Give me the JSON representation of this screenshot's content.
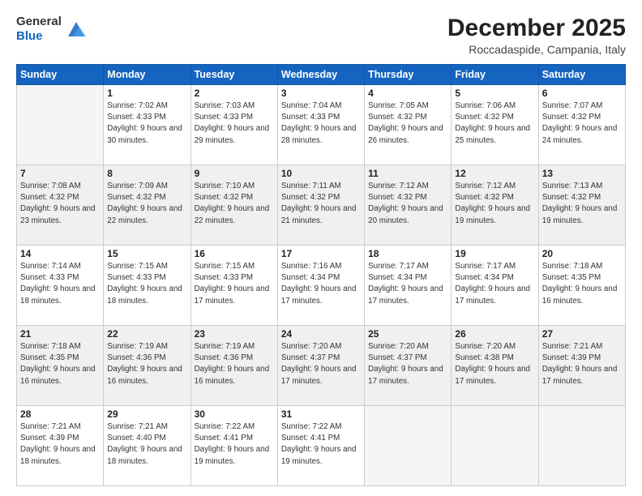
{
  "logo": {
    "general": "General",
    "blue": "Blue"
  },
  "header": {
    "month": "December 2025",
    "location": "Roccadaspide, Campania, Italy"
  },
  "weekdays": [
    "Sunday",
    "Monday",
    "Tuesday",
    "Wednesday",
    "Thursday",
    "Friday",
    "Saturday"
  ],
  "weeks": [
    [
      {
        "day": "",
        "sunrise": "",
        "sunset": "",
        "daylight": ""
      },
      {
        "day": "1",
        "sunrise": "Sunrise: 7:02 AM",
        "sunset": "Sunset: 4:33 PM",
        "daylight": "Daylight: 9 hours and 30 minutes."
      },
      {
        "day": "2",
        "sunrise": "Sunrise: 7:03 AM",
        "sunset": "Sunset: 4:33 PM",
        "daylight": "Daylight: 9 hours and 29 minutes."
      },
      {
        "day": "3",
        "sunrise": "Sunrise: 7:04 AM",
        "sunset": "Sunset: 4:33 PM",
        "daylight": "Daylight: 9 hours and 28 minutes."
      },
      {
        "day": "4",
        "sunrise": "Sunrise: 7:05 AM",
        "sunset": "Sunset: 4:32 PM",
        "daylight": "Daylight: 9 hours and 26 minutes."
      },
      {
        "day": "5",
        "sunrise": "Sunrise: 7:06 AM",
        "sunset": "Sunset: 4:32 PM",
        "daylight": "Daylight: 9 hours and 25 minutes."
      },
      {
        "day": "6",
        "sunrise": "Sunrise: 7:07 AM",
        "sunset": "Sunset: 4:32 PM",
        "daylight": "Daylight: 9 hours and 24 minutes."
      }
    ],
    [
      {
        "day": "7",
        "sunrise": "Sunrise: 7:08 AM",
        "sunset": "Sunset: 4:32 PM",
        "daylight": "Daylight: 9 hours and 23 minutes."
      },
      {
        "day": "8",
        "sunrise": "Sunrise: 7:09 AM",
        "sunset": "Sunset: 4:32 PM",
        "daylight": "Daylight: 9 hours and 22 minutes."
      },
      {
        "day": "9",
        "sunrise": "Sunrise: 7:10 AM",
        "sunset": "Sunset: 4:32 PM",
        "daylight": "Daylight: 9 hours and 22 minutes."
      },
      {
        "day": "10",
        "sunrise": "Sunrise: 7:11 AM",
        "sunset": "Sunset: 4:32 PM",
        "daylight": "Daylight: 9 hours and 21 minutes."
      },
      {
        "day": "11",
        "sunrise": "Sunrise: 7:12 AM",
        "sunset": "Sunset: 4:32 PM",
        "daylight": "Daylight: 9 hours and 20 minutes."
      },
      {
        "day": "12",
        "sunrise": "Sunrise: 7:12 AM",
        "sunset": "Sunset: 4:32 PM",
        "daylight": "Daylight: 9 hours and 19 minutes."
      },
      {
        "day": "13",
        "sunrise": "Sunrise: 7:13 AM",
        "sunset": "Sunset: 4:32 PM",
        "daylight": "Daylight: 9 hours and 19 minutes."
      }
    ],
    [
      {
        "day": "14",
        "sunrise": "Sunrise: 7:14 AM",
        "sunset": "Sunset: 4:33 PM",
        "daylight": "Daylight: 9 hours and 18 minutes."
      },
      {
        "day": "15",
        "sunrise": "Sunrise: 7:15 AM",
        "sunset": "Sunset: 4:33 PM",
        "daylight": "Daylight: 9 hours and 18 minutes."
      },
      {
        "day": "16",
        "sunrise": "Sunrise: 7:15 AM",
        "sunset": "Sunset: 4:33 PM",
        "daylight": "Daylight: 9 hours and 17 minutes."
      },
      {
        "day": "17",
        "sunrise": "Sunrise: 7:16 AM",
        "sunset": "Sunset: 4:34 PM",
        "daylight": "Daylight: 9 hours and 17 minutes."
      },
      {
        "day": "18",
        "sunrise": "Sunrise: 7:17 AM",
        "sunset": "Sunset: 4:34 PM",
        "daylight": "Daylight: 9 hours and 17 minutes."
      },
      {
        "day": "19",
        "sunrise": "Sunrise: 7:17 AM",
        "sunset": "Sunset: 4:34 PM",
        "daylight": "Daylight: 9 hours and 17 minutes."
      },
      {
        "day": "20",
        "sunrise": "Sunrise: 7:18 AM",
        "sunset": "Sunset: 4:35 PM",
        "daylight": "Daylight: 9 hours and 16 minutes."
      }
    ],
    [
      {
        "day": "21",
        "sunrise": "Sunrise: 7:18 AM",
        "sunset": "Sunset: 4:35 PM",
        "daylight": "Daylight: 9 hours and 16 minutes."
      },
      {
        "day": "22",
        "sunrise": "Sunrise: 7:19 AM",
        "sunset": "Sunset: 4:36 PM",
        "daylight": "Daylight: 9 hours and 16 minutes."
      },
      {
        "day": "23",
        "sunrise": "Sunrise: 7:19 AM",
        "sunset": "Sunset: 4:36 PM",
        "daylight": "Daylight: 9 hours and 16 minutes."
      },
      {
        "day": "24",
        "sunrise": "Sunrise: 7:20 AM",
        "sunset": "Sunset: 4:37 PM",
        "daylight": "Daylight: 9 hours and 17 minutes."
      },
      {
        "day": "25",
        "sunrise": "Sunrise: 7:20 AM",
        "sunset": "Sunset: 4:37 PM",
        "daylight": "Daylight: 9 hours and 17 minutes."
      },
      {
        "day": "26",
        "sunrise": "Sunrise: 7:20 AM",
        "sunset": "Sunset: 4:38 PM",
        "daylight": "Daylight: 9 hours and 17 minutes."
      },
      {
        "day": "27",
        "sunrise": "Sunrise: 7:21 AM",
        "sunset": "Sunset: 4:39 PM",
        "daylight": "Daylight: 9 hours and 17 minutes."
      }
    ],
    [
      {
        "day": "28",
        "sunrise": "Sunrise: 7:21 AM",
        "sunset": "Sunset: 4:39 PM",
        "daylight": "Daylight: 9 hours and 18 minutes."
      },
      {
        "day": "29",
        "sunrise": "Sunrise: 7:21 AM",
        "sunset": "Sunset: 4:40 PM",
        "daylight": "Daylight: 9 hours and 18 minutes."
      },
      {
        "day": "30",
        "sunrise": "Sunrise: 7:22 AM",
        "sunset": "Sunset: 4:41 PM",
        "daylight": "Daylight: 9 hours and 19 minutes."
      },
      {
        "day": "31",
        "sunrise": "Sunrise: 7:22 AM",
        "sunset": "Sunset: 4:41 PM",
        "daylight": "Daylight: 9 hours and 19 minutes."
      },
      {
        "day": "",
        "sunrise": "",
        "sunset": "",
        "daylight": ""
      },
      {
        "day": "",
        "sunrise": "",
        "sunset": "",
        "daylight": ""
      },
      {
        "day": "",
        "sunrise": "",
        "sunset": "",
        "daylight": ""
      }
    ]
  ]
}
